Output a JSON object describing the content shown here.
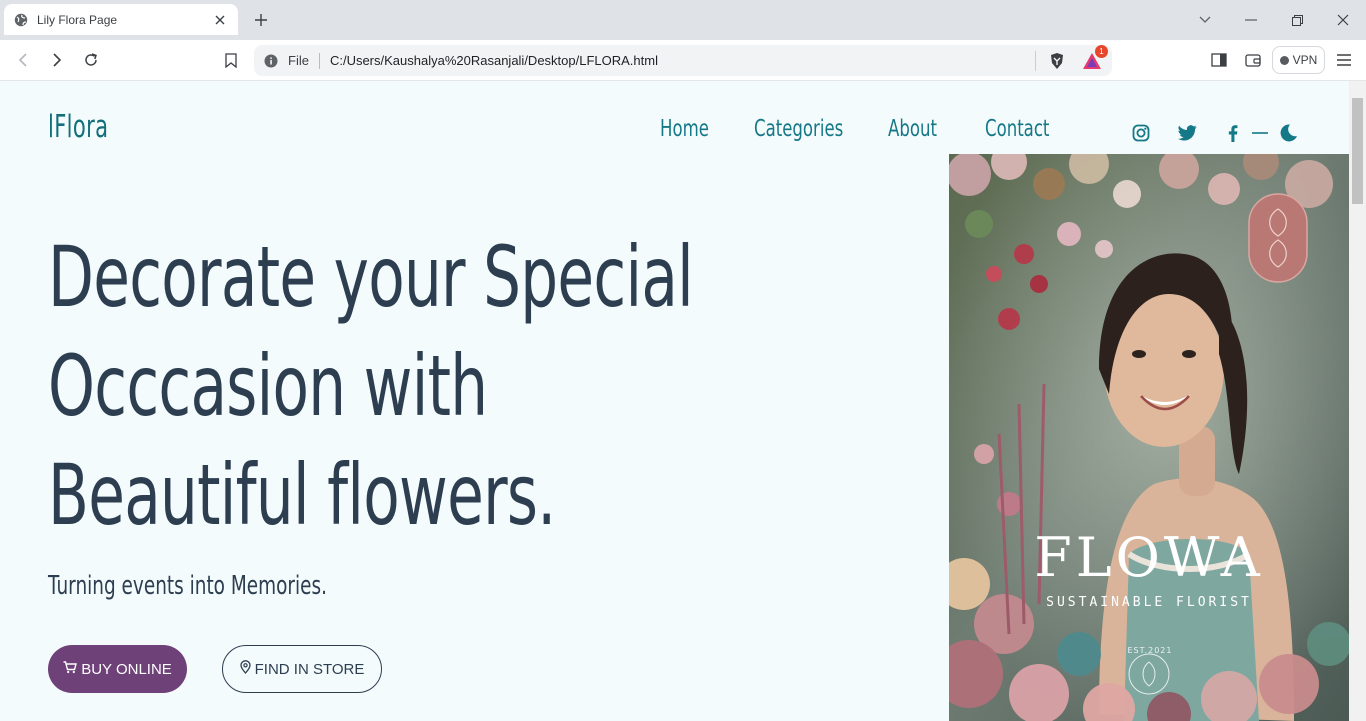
{
  "browser": {
    "tab": {
      "title": "Lily Flora Page"
    },
    "address": {
      "scheme": "File",
      "url": "C:/Users/Kaushalya%20Rasanjali/Desktop/LFLORA.html"
    },
    "rewards_badge": "1",
    "vpn_label": "VPN"
  },
  "site": {
    "logo": "lFlora",
    "nav": [
      "Home",
      "Categories",
      "About",
      "Contact"
    ],
    "social_icons": [
      "instagram-icon",
      "twitter-icon",
      "facebook-icon",
      "dash-icon",
      "moon-icon"
    ],
    "hero": {
      "title": "Decorate your Special Occcasion with Beautiful flowers.",
      "subtitle": "Turning events into Memories.",
      "buy_button": "BUY ONLINE",
      "store_button": "FIND IN STORE"
    },
    "image": {
      "brand_name": "FLOWA",
      "brand_tagline": "SUSTAINABLE FLORIST",
      "established": "EST.2021"
    }
  },
  "colors": {
    "page_bg": "#f4fbfc",
    "brand_teal": "#157887",
    "heading": "#2c3e50",
    "buy_button_bg": "#6e4178"
  }
}
